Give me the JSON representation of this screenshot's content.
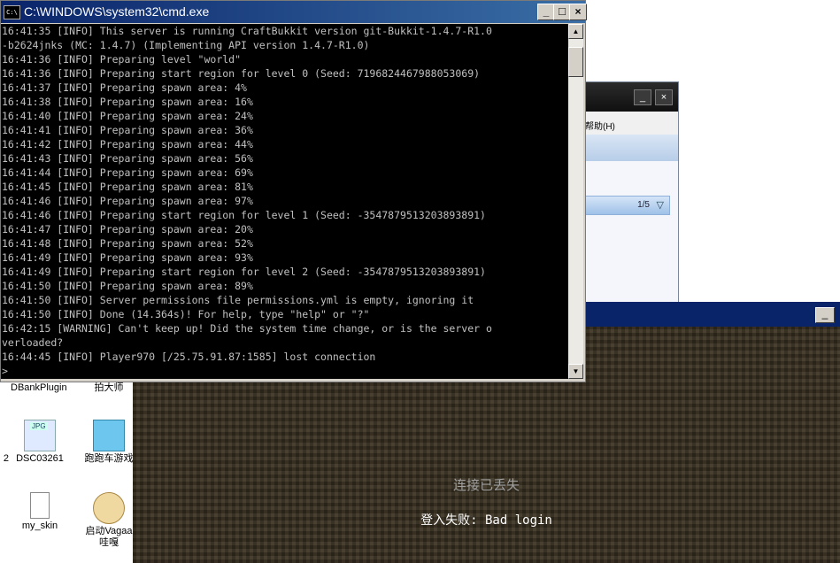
{
  "cmd": {
    "title": "C:\\WINDOWS\\system32\\cmd.exe",
    "icon_text": "C:\\",
    "minimize": "_",
    "maximize": "□",
    "close": "×",
    "lines": [
      "16:41:35 [INFO] This server is running CraftBukkit version git-Bukkit-1.4.7-R1.0",
      "-b2624jnks (MC: 1.4.7) (Implementing API version 1.4.7-R1.0)",
      "16:41:36 [INFO] Preparing level \"world\"",
      "16:41:36 [INFO] Preparing start region for level 0 (Seed: 7196824467988053069)",
      "16:41:37 [INFO] Preparing spawn area: 4%",
      "16:41:38 [INFO] Preparing spawn area: 16%",
      "16:41:40 [INFO] Preparing spawn area: 24%",
      "16:41:41 [INFO] Preparing spawn area: 36%",
      "16:41:42 [INFO] Preparing spawn area: 44%",
      "16:41:43 [INFO] Preparing spawn area: 56%",
      "16:41:44 [INFO] Preparing spawn area: 69%",
      "16:41:45 [INFO] Preparing spawn area: 81%",
      "16:41:46 [INFO] Preparing spawn area: 97%",
      "16:41:46 [INFO] Preparing start region for level 1 (Seed: -3547879513203893891)",
      "16:41:47 [INFO] Preparing spawn area: 20%",
      "16:41:48 [INFO] Preparing spawn area: 52%",
      "16:41:49 [INFO] Preparing spawn area: 93%",
      "16:41:49 [INFO] Preparing start region for level 2 (Seed: -3547879513203893891)",
      "16:41:50 [INFO] Preparing spawn area: 89%",
      "16:41:50 [INFO] Server permissions file permissions.yml is empty, ignoring it",
      "16:41:50 [INFO] Done (14.364s)! For help, type \"help\" or \"?\"",
      "16:42:15 [WARNING] Can't keep up! Did the system time change, or is the server o",
      "verloaded?",
      "16:44:45 [INFO] Player970 [/25.75.91.87:1585] lost connection",
      ">"
    ]
  },
  "background_window": {
    "menu_label": "帮助(H)",
    "pager": "1/5",
    "minimize": "_",
    "close": "×"
  },
  "desktop": {
    "icons": [
      {
        "label": "DBankPlugin"
      },
      {
        "label": "拍大师"
      },
      {
        "label": "DSC03261"
      },
      {
        "label": "跑跑车游戏"
      },
      {
        "label": "my_skin"
      },
      {
        "label": "启动Vagaa哇嘎"
      },
      {
        "label": "2"
      }
    ],
    "thumb_label": "JPG"
  },
  "minecraft": {
    "minimize": "_",
    "lost_connection": "连接已丢失",
    "login_failed": "登入失败: Bad login"
  }
}
